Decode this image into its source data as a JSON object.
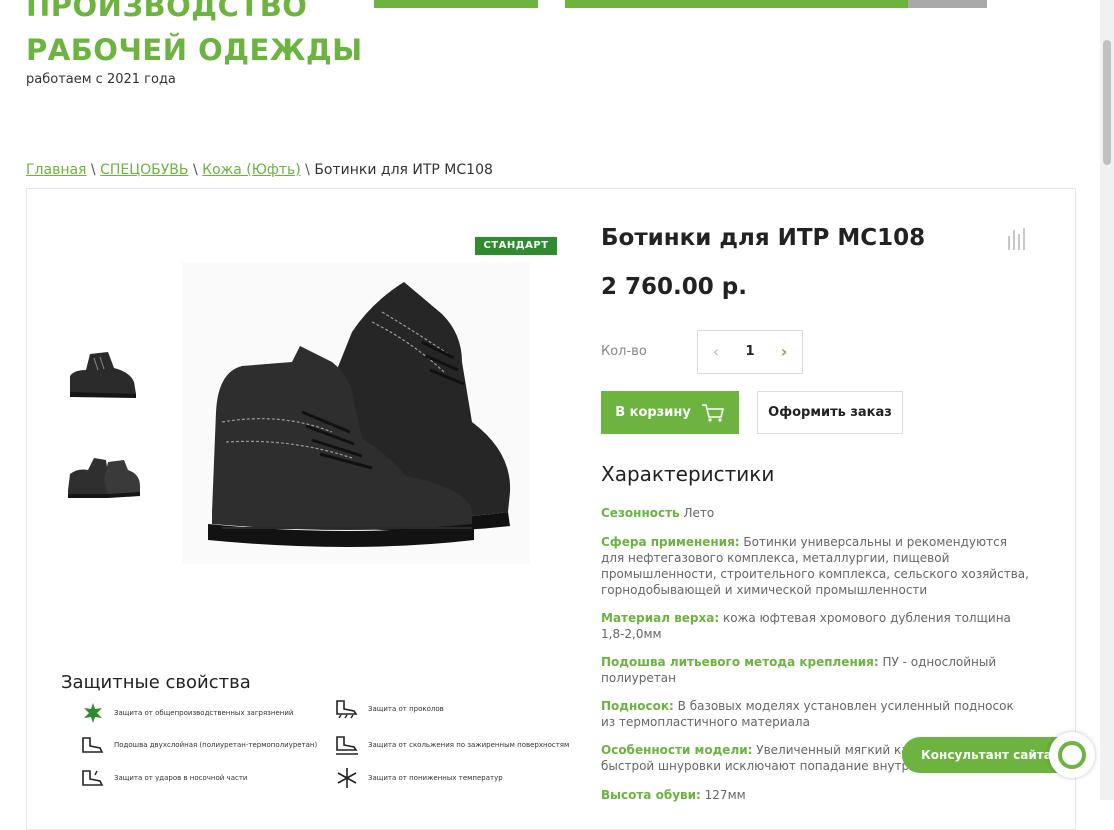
{
  "header": {
    "brand_line1": "ПРОИЗВОДСТВО",
    "brand_line2": "РАБОЧЕЙ ОДЕЖДЫ",
    "brand_sub": "работаем с 2021 года"
  },
  "breadcrumb": {
    "home": "Главная",
    "cat1": "СПЕЦОБУВЬ",
    "cat2": "Кожа (Юфть)",
    "current": "Ботинки для ИТР МС108",
    "sep": " \\ "
  },
  "product": {
    "badge": "СТАНДАРТ",
    "title": "Ботинки для ИТР МС108",
    "price": "2 760.00 р.",
    "qty_label": "Кол-во",
    "qty_value": "1",
    "qty_dec": "‹",
    "qty_inc": "›",
    "cart_label": "В корзину",
    "order_label": "Оформить заказ"
  },
  "characteristics": {
    "title": "Характеристики",
    "items": [
      {
        "key": "Сезонность",
        "value": " Лето"
      },
      {
        "key": "Сфера применения:",
        "value": " Ботинки универсальны и рекомендуются для нефтегазового комплекса, металлургии, пищевой промышленности, строительного комплекса, сельского хозяйства, горнодобывающей и химической промышленности"
      },
      {
        "key": "Материал верха:",
        "value": " кожа юфтевая хромового дубления толщина 1,8-2,0мм"
      },
      {
        "key": "Подошва литьевого метода крепления:",
        "value": " ПУ - однослойный полиуретан"
      },
      {
        "key": "Подносок:",
        "value": " В базовых моделях установлен усиленный подносок из термопластичного материала"
      },
      {
        "key": "Особенности модели:",
        "value": " Увеличенный мягкий кант и клапан быстрой шнуровки исключают попадание внутрь"
      },
      {
        "key": "Высота обуви:",
        "value": " 127мм"
      }
    ]
  },
  "protection": {
    "title": "Защитные свойства",
    "items": [
      "Защита от общепроизводственных загрязнений",
      "Подошва двухслойная (полиуретан-термополиуретан)",
      "Защита от ударов в носочной части",
      "Защита от проколов",
      "Защита от скольжения по зажиренным поверхностям",
      "Защита от пониженных температур"
    ]
  },
  "consultant": {
    "label": "Консультант сайта"
  },
  "colors": {
    "accent": "#6cb33f",
    "badge": "#2e8b2e"
  }
}
